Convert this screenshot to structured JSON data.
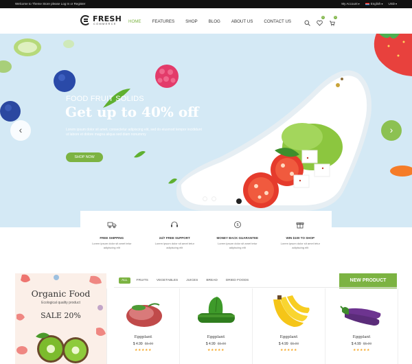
{
  "topbar": {
    "welcome": "Welcome to Theme Store please Log In or Register",
    "account": "My Account",
    "language": "English",
    "currency": "USD"
  },
  "brand": {
    "name": "FRESH",
    "tagline": "COMMERCE"
  },
  "nav": [
    "HOME",
    "FEATURES",
    "SHOP",
    "BLOG",
    "ABOUT US",
    "CONTACT US"
  ],
  "header_icons": {
    "wishlist_count": "0",
    "cart_count": "0"
  },
  "hero": {
    "subtitle": "FOOD FRUIT SOLIDS",
    "title": "Get up to 40% off",
    "description": "Lorem ipsum dolor sit amet, consectetur adipiscing elit, sed do eiusmod tempor incididunt ut labore et dolore magna aliqua sed diam nonummy",
    "button": "SHOP NOW",
    "prev_icon": "chevron-left-icon",
    "next_icon": "chevron-right-icon",
    "active_slide": 1,
    "slide_count": 2
  },
  "features": [
    {
      "icon": "truck-icon",
      "title": "FREE SHIPPING",
      "text": "Lorem ipsum dolor sit amet tetur adipiscing elit"
    },
    {
      "icon": "headset-icon",
      "title": "24/7 FREE SUPPORT",
      "text": "Lorem ipsum dolor sit amet tetur adipiscing elit"
    },
    {
      "icon": "money-back-icon",
      "title": "MONEY BACK GUARANTEE",
      "text": "Lorem ipsum dolor sit amet tetur adipiscing elit"
    },
    {
      "icon": "gift-icon",
      "title": "WIN $100 TO SHOP",
      "text": "Lorem ipsum dolor sit amet tetur adipiscing elit"
    }
  ],
  "promo": {
    "title": "Organic Food",
    "tagline": "Ecological quality product",
    "sale": "SALE 20%"
  },
  "filters": [
    "ALL",
    "FRUITS",
    "VEGETABLES",
    "JUICES",
    "BREAD",
    "DRIED FOODS"
  ],
  "new_product_label": "NEW PRODUCT",
  "products": [
    {
      "name": "Eggplant",
      "price": "$ 4.99",
      "old_price": "$5.99",
      "rating": "★★★★★",
      "image": "meat-icon"
    },
    {
      "name": "Eggplant",
      "price": "$ 4.99",
      "old_price": "$5.99",
      "rating": "★★★★★",
      "image": "cucumber-icon"
    },
    {
      "name": "Eggplant",
      "price": "$ 4.99",
      "old_price": "$5.99",
      "rating": "★★★★★",
      "image": "banana-icon"
    },
    {
      "name": "Eggplant",
      "price": "$ 4.99",
      "old_price": "$5.99",
      "rating": "★★★★★",
      "image": "eggplant-icon"
    }
  ],
  "colors": {
    "accent": "#7cb342",
    "hero_bg": "#d4e9f5",
    "topbar": "#111111",
    "promo_bg": "#fbefe8"
  }
}
